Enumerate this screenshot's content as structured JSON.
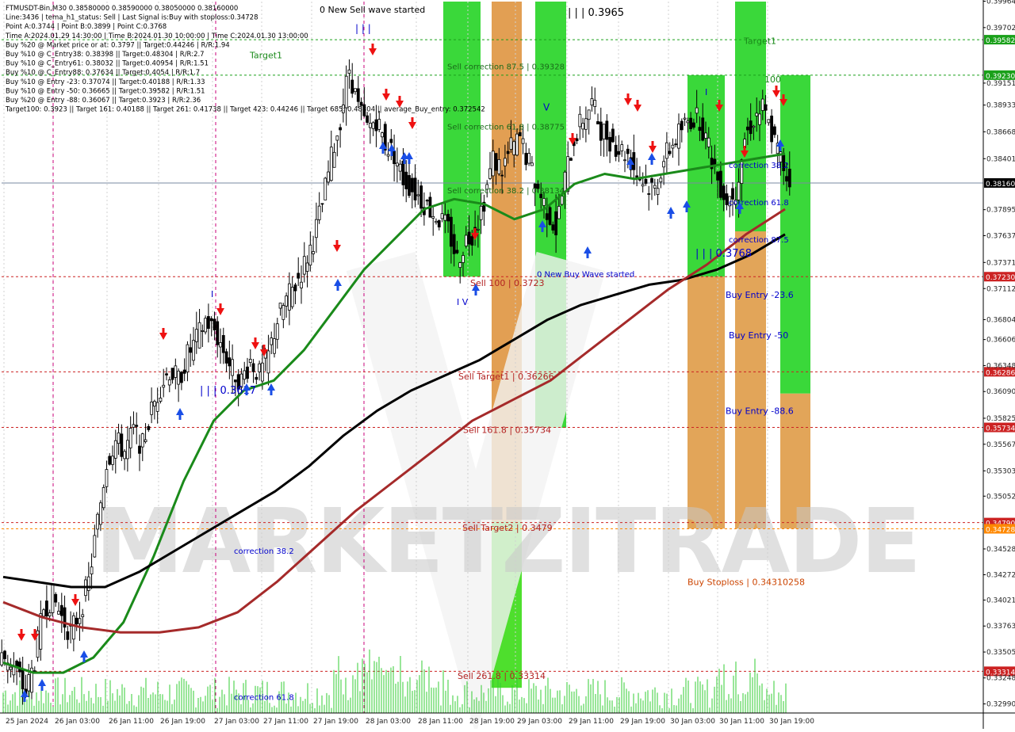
{
  "header": {
    "lines": [
      "FTMUSDT-Bin,M30   0.38580000 0.38590000 0.38050000 0.38160000",
      "Line:3436 | tema_h1_status: Sell | Last Signal is:Buy with stoploss:0.34728",
      "Point A:0.3744 | Point B:0.3899 | Point C:0.3768",
      "Time A:2024.01.29 14:30:00 | Time B:2024.01.30 10:00:00 | Time C:2024.01.30 13:00:00",
      "Buy %20 @ Market price or at: 0.3797 || Target:0.44246 | R/R:1.94",
      "Buy %10 @ C_Entry38: 0.38398 || Target:0.48304 | R/R:2.7",
      "Buy %10 @ C_Entry61: 0.38032 || Target:0.40954 | R/R:1.51",
      "Buy %10 @ C_Entry88: 0.37634 || Target:0.4054 | R/R:1.7",
      "Buy %10 @ Entry -23: 0.37074 || Target:0.40188 | R/R:1.33",
      "Buy %10 @ Entry -50: 0.36665 || Target:0.39582 | R/R:1.51",
      "Buy %20 @ Entry -88: 0.36067 || Target:0.3923 | R/R:2.36",
      "Target100: 0.3923 || Target 161: 0.40188 || Target 261: 0.41738 || Target 423: 0.44246 || Target 685: 0.48304 || average_Buy_entry: 0.372542"
    ]
  },
  "watermark": "MARKETZITRADE",
  "chart_data": {
    "type": "candlestick",
    "symbol": "FTMUSDT-Bin",
    "timeframe": "M30",
    "ylim": [
      0.329,
      0.3996
    ],
    "x_tick_labels": [
      "25 Jan 2024",
      "26 Jan 03:00",
      "26 Jan 11:00",
      "26 Jan 19:00",
      "27 Jan 03:00",
      "27 Jan 11:00",
      "27 Jan 19:00",
      "28 Jan 03:00",
      "28 Jan 11:00",
      "28 Jan 19:00",
      "29 Jan 03:00",
      "29 Jan 11:00",
      "29 Jan 19:00",
      "30 Jan 03:00",
      "30 Jan 11:00",
      "30 Jan 19:00"
    ],
    "y_tick_labels": [
      "0.39964",
      "0.39702",
      "0.39151",
      "0.38933",
      "0.38668",
      "0.38401",
      "0.37895",
      "0.37637",
      "0.37371",
      "0.37112",
      "0.36804",
      "0.36606",
      "0.36348",
      "0.36090",
      "0.35825",
      "0.35567",
      "0.35303",
      "0.35052",
      "0.34528",
      "0.34272",
      "0.34021",
      "0.33763",
      "0.33505",
      "0.33248",
      "0.32990"
    ],
    "current_price": 0.3816,
    "close_path": [
      0.3345,
      0.333,
      0.331,
      0.3342,
      0.3395,
      0.3405,
      0.3385,
      0.337,
      0.339,
      0.342,
      0.348,
      0.354,
      0.356,
      0.355,
      0.357,
      0.3555,
      0.359,
      0.3615,
      0.363,
      0.362,
      0.3645,
      0.366,
      0.368,
      0.367,
      0.365,
      0.363,
      0.362,
      0.364,
      0.3625,
      0.3645,
      0.368,
      0.37,
      0.3715,
      0.3735,
      0.376,
      0.3795,
      0.384,
      0.388,
      0.393,
      0.389,
      0.387,
      0.388,
      0.3855,
      0.3845,
      0.382,
      0.381,
      0.38,
      0.379,
      0.378,
      0.377,
      0.374,
      0.376,
      0.377,
      0.38,
      0.384,
      0.383,
      0.385,
      0.386,
      0.3835,
      0.381,
      0.379,
      0.377,
      0.382,
      0.386,
      0.388,
      0.3895,
      0.387,
      0.386,
      0.385,
      0.3845,
      0.3825,
      0.3815,
      0.381,
      0.384,
      0.3855,
      0.387,
      0.388,
      0.388,
      0.385,
      0.382,
      0.38,
      0.381,
      0.386,
      0.388,
      0.389,
      0.3865,
      0.384,
      0.3816
    ],
    "moving_averages": [
      {
        "color": "#1a8a1a",
        "values": [
          0.334,
          0.333,
          0.333,
          0.3345,
          0.338,
          0.3445,
          0.352,
          0.358,
          0.361,
          0.362,
          0.365,
          0.369,
          0.373,
          0.376,
          0.379,
          0.38,
          0.3795,
          0.378,
          0.379,
          0.3815,
          0.3825,
          0.382,
          0.3825,
          0.383,
          0.3835,
          0.384,
          0.3845
        ]
      },
      {
        "color": "#000000",
        "values": [
          0.3425,
          0.342,
          0.3415,
          0.3415,
          0.343,
          0.345,
          0.347,
          0.349,
          0.351,
          0.3535,
          0.3565,
          0.359,
          0.361,
          0.3625,
          0.364,
          0.366,
          0.368,
          0.3695,
          0.3705,
          0.3715,
          0.372,
          0.373,
          0.3745,
          0.3765
        ]
      },
      {
        "color": "#a52a2a",
        "values": [
          0.34,
          0.3385,
          0.3375,
          0.337,
          0.337,
          0.3375,
          0.339,
          0.342,
          0.3455,
          0.349,
          0.352,
          0.355,
          0.358,
          0.36,
          0.362,
          0.365,
          0.368,
          0.371,
          0.3735,
          0.3765,
          0.379
        ]
      }
    ],
    "level_labels": [
      {
        "text": "Target1",
        "price": 0.3943
      },
      {
        "text": "Target1",
        "price": 0.3957
      },
      {
        "text": "0 New Sell wave started",
        "price": 0.3988
      },
      {
        "text": "| | | 0.3965",
        "price": 0.3985
      },
      {
        "text": "Sell correction 87.5 | 0.39328",
        "price": 0.3932
      },
      {
        "text": "Sell correction 61.8 | 0.38775",
        "price": 0.3872
      },
      {
        "text": "Sell correction 38.2 | 0.38134",
        "price": 0.3809
      },
      {
        "text": "V",
        "price": 0.3891
      },
      {
        "text": "| | | 0.3617",
        "price": 0.361
      },
      {
        "text": "Sell 100 | 0.3723",
        "price": 0.3717
      },
      {
        "text": "0 New Buy Wave started",
        "price": 0.3726
      },
      {
        "text": "Sell Target1 | 0.36266",
        "price": 0.3624
      },
      {
        "text": "Sell 161.8 | 0.35734",
        "price": 0.3571
      },
      {
        "text": "Sell Target2 | 0.3479",
        "price": 0.3474
      },
      {
        "text": "Sell 261.8 | 0.33314",
        "price": 0.3327
      },
      {
        "text": "correction 38.2",
        "price": 0.3834
      },
      {
        "text": "correction 61.8",
        "price": 0.3797
      },
      {
        "text": "correction 87.5",
        "price": 0.376
      },
      {
        "text": "| | | 0.3768",
        "price": 0.3746
      },
      {
        "text": "100",
        "price": 0.3919
      },
      {
        "text": "Buy Entry -23.6",
        "price": 0.3705
      },
      {
        "text": "Buy Entry -50",
        "price": 0.3665
      },
      {
        "text": "Buy Entry -88.6",
        "price": 0.359
      },
      {
        "text": "Buy Stoploss | 0.34310258",
        "price": 0.342
      },
      {
        "text": "correction 38.2",
        "price": 0.3451
      },
      {
        "text": "correction 61.8",
        "price": 0.3306
      }
    ],
    "hlines": [
      {
        "price": 0.39582,
        "label": "0.39582",
        "color": "#1aa01a"
      },
      {
        "price": 0.3923,
        "label": "0.39230",
        "color": "#1aa01a"
      },
      {
        "price": 0.3816,
        "label": "0.38160",
        "color": "#000000"
      },
      {
        "price": 0.3723,
        "label": "0.37230",
        "color": "#cc2222"
      },
      {
        "price": 0.36286,
        "label": "0.36286",
        "color": "#cc2222"
      },
      {
        "price": 0.35734,
        "label": "0.35734",
        "color": "#cc2222"
      },
      {
        "price": 0.3479,
        "label": "0.34790",
        "color": "#cc2222"
      },
      {
        "price": 0.34728,
        "label": "0.34728",
        "color": "#ff8800"
      },
      {
        "price": 0.33314,
        "label": "0.33314",
        "color": "#cc2222"
      }
    ]
  }
}
